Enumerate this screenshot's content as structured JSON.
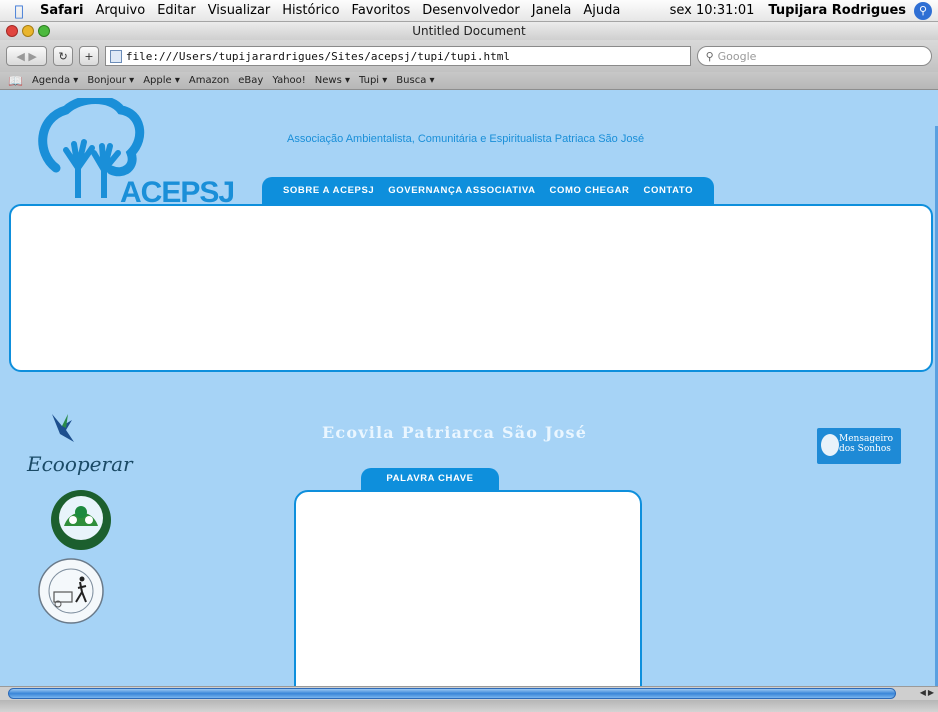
{
  "menubar": {
    "app": "Safari",
    "items": [
      "Arquivo",
      "Editar",
      "Visualizar",
      "Histórico",
      "Favoritos",
      "Desenvolvedor",
      "Janela",
      "Ajuda"
    ],
    "clock": "sex 10:31:01",
    "user": "Tupijara Rodrigues"
  },
  "window": {
    "title": "Untitled Document"
  },
  "toolbar": {
    "address": "file:///Users/tupijarardrigues/Sites/acepsj/tupi/tupi.html",
    "search_placeholder": "Google"
  },
  "bookmarks": [
    "Agenda ▾",
    "Bonjour ▾",
    "Apple ▾",
    "Amazon",
    "eBay",
    "Yahoo!",
    "News ▾",
    "Tupi ▾",
    "Busca ▾"
  ],
  "site": {
    "logo_text": "ACEPSJ",
    "org_name": "Associação Ambientalista, Comunitária  e Espiritualista Patriaca São José",
    "nav": [
      "SOBRE A ACEPSJ",
      "GOVERNANÇA ASSOCIATIVA",
      "COMO CHEGAR",
      "CONTATO"
    ],
    "eco_title": "Ecovila Patriarca São José",
    "keyword_tab": "PALAVRA CHAVE",
    "partners": {
      "ecooperar": "Ecooperar",
      "mensageiro_line1": "Mensageiro",
      "mensageiro_line2": "dos Sonhos"
    }
  },
  "colors": {
    "background": "#a6d3f6",
    "accent": "#0e8fdc",
    "panel": "#ffffff"
  }
}
